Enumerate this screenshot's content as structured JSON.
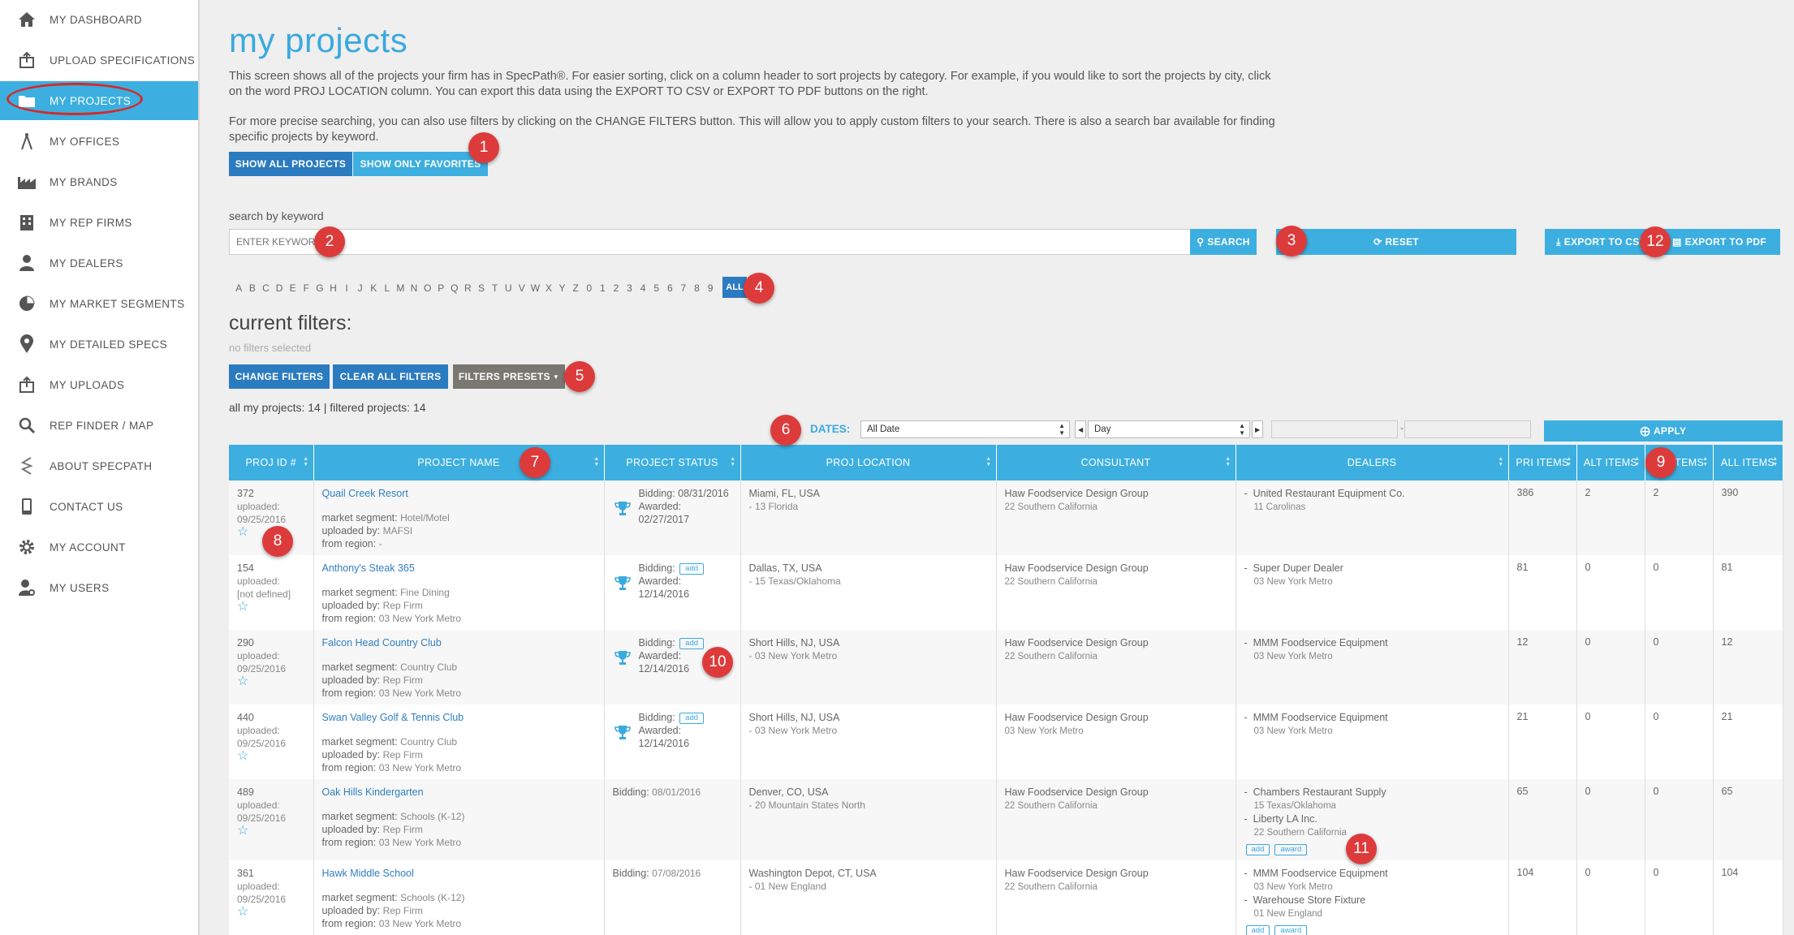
{
  "sidebar": {
    "items": [
      {
        "label": "MY DASHBOARD",
        "icon": "home-icon"
      },
      {
        "label": "UPLOAD SPECIFICATIONS",
        "icon": "upload-icon"
      },
      {
        "label": "MY PROJECTS",
        "icon": "folder-icon",
        "active": true
      },
      {
        "label": "MY OFFICES",
        "icon": "compass-icon"
      },
      {
        "label": "MY BRANDS",
        "icon": "factory-icon"
      },
      {
        "label": "MY REP FIRMS",
        "icon": "building-icon"
      },
      {
        "label": "MY DEALERS",
        "icon": "user-icon"
      },
      {
        "label": "MY MARKET SEGMENTS",
        "icon": "pie-chart-icon"
      },
      {
        "label": "MY DETAILED SPECS",
        "icon": "map-pin-icon"
      },
      {
        "label": "MY UPLOADS",
        "icon": "upload-icon"
      },
      {
        "label": "REP FINDER / MAP",
        "icon": "search-icon"
      },
      {
        "label": "ABOUT SPECPATH",
        "icon": "specpath-logo-icon"
      },
      {
        "label": "CONTACT US",
        "icon": "phone-icon"
      },
      {
        "label": "MY ACCOUNT",
        "icon": "gear-icon"
      },
      {
        "label": "MY USERS",
        "icon": "user-gear-icon"
      }
    ]
  },
  "page": {
    "title": "my projects",
    "intro1": "This screen shows all of the projects your firm has in SpecPath®. For easier sorting, click on a column header to sort projects by category. For example, if you would like to sort the projects by city, click on the word PROJ LOCATION column. You can export this data using the EXPORT TO CSV or EXPORT TO PDF buttons on the right.",
    "intro2": "For more precise searching, you can also use filters by clicking on the CHANGE FILTERS button. This will allow you to apply custom filters to your search. There is also a search bar available for finding specific projects by keyword."
  },
  "toggles": {
    "show_all": "SHOW ALL PROJECTS",
    "show_favorites": "SHOW ONLY FAVORITES"
  },
  "search": {
    "label": "search by keyword",
    "placeholder": "ENTER KEYWORD",
    "search_btn": "SEARCH",
    "reset_btn": "RESET",
    "export_csv": "EXPORT TO CSV",
    "export_pdf": "EXPORT TO PDF"
  },
  "alphabet": [
    "A",
    "B",
    "C",
    "D",
    "E",
    "F",
    "G",
    "H",
    "I",
    "J",
    "K",
    "L",
    "M",
    "N",
    "O",
    "P",
    "Q",
    "R",
    "S",
    "T",
    "U",
    "V",
    "W",
    "X",
    "Y",
    "Z",
    "0",
    "1",
    "2",
    "3",
    "4",
    "5",
    "6",
    "7",
    "8",
    "9"
  ],
  "alphabet_all": "ALL",
  "filters": {
    "title": "current filters:",
    "none": "no filters selected",
    "change": "CHANGE FILTERS",
    "clear": "CLEAR ALL FILTERS",
    "presets": "FILTERS PRESETS",
    "counts": "all my projects: 14 | filtered projects: 14"
  },
  "dates": {
    "label": "DATES:",
    "range_value": "All Date",
    "unit_value": "Day",
    "apply": "APPLY"
  },
  "table": {
    "headers": [
      "PROJ ID #",
      "PROJECT NAME",
      "PROJECT STATUS",
      "PROJ LOCATION",
      "CONSULTANT",
      "DEALERS",
      "PRI ITEMS",
      "ALT ITEMS",
      "EQ ITEMS",
      "ALL ITEMS"
    ],
    "rows": [
      {
        "id": "372",
        "uploaded_label": "uploaded:",
        "uploaded": "09/25/2016",
        "name": "Quail Creek Resort",
        "segment_label": "market segment:",
        "segment": "Hotel/Motel",
        "by_label": "uploaded by:",
        "by": "MAFSI",
        "region_label": "from region:",
        "region": "-",
        "trophy": true,
        "bidding_label": "Bidding:",
        "bidding": "08/31/2016",
        "awarded_label": "Awarded:",
        "awarded": "02/27/2017",
        "bid_add": "",
        "loc": "Miami, FL, USA",
        "loc_sub": "- 13 Florida",
        "consultant": "Haw Foodservice Design Group",
        "consultant_sub": "22 Southern California",
        "dealers": [
          {
            "name": "United Restaurant Equipment Co.",
            "sub": "11 Carolinas"
          }
        ],
        "dealer_tags": [],
        "pri": "386",
        "alt": "2",
        "eq": "2",
        "all": "390"
      },
      {
        "id": "154",
        "uploaded_label": "uploaded:",
        "uploaded": "[not defined]",
        "name": "Anthony's Steak 365",
        "segment_label": "market segment:",
        "segment": "Fine Dining",
        "by_label": "uploaded by:",
        "by": "Rep Firm",
        "region_label": "from region:",
        "region": "03 New York Metro",
        "trophy": true,
        "bidding_label": "Bidding:",
        "bidding": "",
        "awarded_label": "Awarded:",
        "awarded": "12/14/2016",
        "bid_add": "add",
        "loc": "Dallas, TX, USA",
        "loc_sub": "- 15 Texas/Oklahoma",
        "consultant": "Haw Foodservice Design Group",
        "consultant_sub": "22 Southern California",
        "dealers": [
          {
            "name": "Super Duper Dealer",
            "sub": "03 New York Metro"
          }
        ],
        "dealer_tags": [],
        "pri": "81",
        "alt": "0",
        "eq": "0",
        "all": "81"
      },
      {
        "id": "290",
        "uploaded_label": "uploaded:",
        "uploaded": "09/25/2016",
        "name": "Falcon Head Country Club",
        "segment_label": "market segment:",
        "segment": "Country Club",
        "by_label": "uploaded by:",
        "by": "Rep Firm",
        "region_label": "from region:",
        "region": "03 New York Metro",
        "trophy": true,
        "bidding_label": "Bidding:",
        "bidding": "",
        "awarded_label": "Awarded:",
        "awarded": "12/14/2016",
        "bid_add": "add",
        "loc": "Short Hills, NJ, USA",
        "loc_sub": "- 03 New York Metro",
        "consultant": "Haw Foodservice Design Group",
        "consultant_sub": "22 Southern California",
        "dealers": [
          {
            "name": "MMM Foodservice Equipment",
            "sub": "03 New York Metro"
          }
        ],
        "dealer_tags": [],
        "pri": "12",
        "alt": "0",
        "eq": "0",
        "all": "12"
      },
      {
        "id": "440",
        "uploaded_label": "uploaded:",
        "uploaded": "09/25/2016",
        "name": "Swan Valley Golf & Tennis Club",
        "segment_label": "market segment:",
        "segment": "Country Club",
        "by_label": "uploaded by:",
        "by": "Rep Firm",
        "region_label": "from region:",
        "region": "03 New York Metro",
        "trophy": true,
        "bidding_label": "Bidding:",
        "bidding": "",
        "awarded_label": "Awarded:",
        "awarded": "12/14/2016",
        "bid_add": "add",
        "loc": "Short Hills, NJ, USA",
        "loc_sub": "- 03 New York Metro",
        "consultant": "Haw Foodservice Design Group",
        "consultant_sub": "03 New York Metro",
        "dealers": [
          {
            "name": "MMM Foodservice Equipment",
            "sub": "03 New York Metro"
          }
        ],
        "dealer_tags": [],
        "pri": "21",
        "alt": "0",
        "eq": "0",
        "all": "21"
      },
      {
        "id": "489",
        "uploaded_label": "uploaded:",
        "uploaded": "09/25/2016",
        "name": "Oak Hills Kindergarten",
        "segment_label": "market segment:",
        "segment": "Schools (K-12)",
        "by_label": "uploaded by:",
        "by": "Rep Firm",
        "region_label": "from region:",
        "region": "03 New York Metro",
        "trophy": false,
        "bidding_label": "Bidding:",
        "bidding": "08/01/2016",
        "awarded_label": "",
        "awarded": "",
        "bid_add": "",
        "loc": "Denver, CO, USA",
        "loc_sub": "- 20 Mountain States North",
        "consultant": "Haw Foodservice Design Group",
        "consultant_sub": "22 Southern California",
        "dealers": [
          {
            "name": "Chambers Restaurant Supply",
            "sub": "15 Texas/Oklahoma"
          },
          {
            "name": "Liberty LA Inc.",
            "sub": "22 Southern California"
          }
        ],
        "dealer_tags": [
          "add",
          "award"
        ],
        "pri": "65",
        "alt": "0",
        "eq": "0",
        "all": "65"
      },
      {
        "id": "361",
        "uploaded_label": "uploaded:",
        "uploaded": "09/25/2016",
        "name": "Hawk Middle School",
        "segment_label": "market segment:",
        "segment": "Schools (K-12)",
        "by_label": "uploaded by:",
        "by": "Rep Firm",
        "region_label": "from region:",
        "region": "03 New York Metro",
        "trophy": false,
        "bidding_label": "Bidding:",
        "bidding": "07/08/2016",
        "awarded_label": "",
        "awarded": "",
        "bid_add": "",
        "loc": "Washington Depot, CT, USA",
        "loc_sub": "- 01 New England",
        "consultant": "Haw Foodservice Design Group",
        "consultant_sub": "22 Southern California",
        "dealers": [
          {
            "name": "MMM Foodservice Equipment",
            "sub": "03 New York Metro"
          },
          {
            "name": "Warehouse Store Fixture",
            "sub": "01 New England"
          }
        ],
        "dealer_tags": [
          "add",
          "award"
        ],
        "pri": "104",
        "alt": "0",
        "eq": "0",
        "all": "104"
      }
    ]
  },
  "markers": [
    "1",
    "2",
    "3",
    "4",
    "5",
    "6",
    "7",
    "8",
    "9",
    "10",
    "11",
    "12"
  ],
  "colors": {
    "accent": "#3cafe0",
    "dark_blue": "#2b7bc0",
    "gray_button": "#7a7672",
    "marker": "#dd3b3b",
    "title": "#3ba9de"
  }
}
